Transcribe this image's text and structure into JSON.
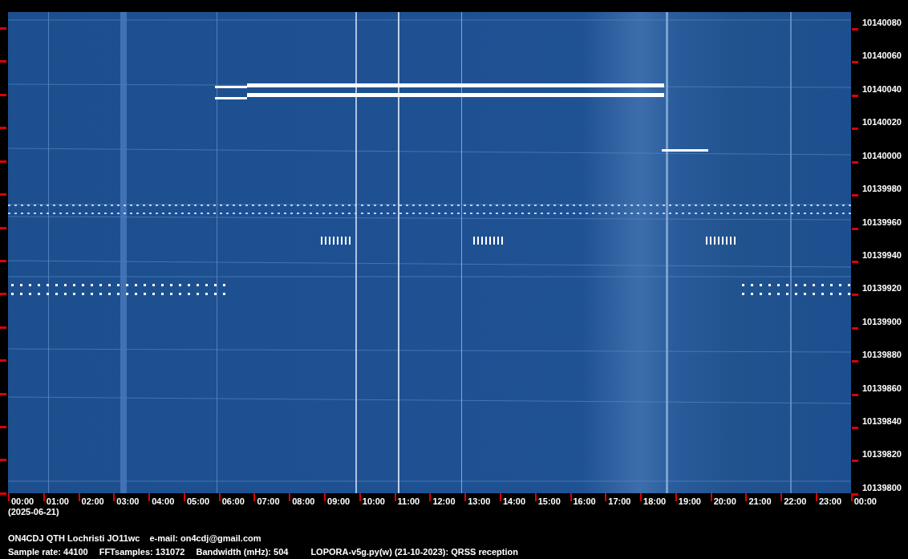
{
  "spectrogram": {
    "y_axis_labels": [
      "10140080",
      "10140060",
      "10140040",
      "10140020",
      "10140000",
      "10139980",
      "10139960",
      "10139940",
      "10139920",
      "10139900",
      "10139880",
      "10139860",
      "10139840",
      "10139820",
      "10139800"
    ],
    "x_axis_labels": [
      "00:00",
      "01:00",
      "02:00",
      "03:00",
      "04:00",
      "05:00",
      "06:00",
      "07:00",
      "08:00",
      "09:00",
      "10:00",
      "11:00",
      "12:00",
      "13:00",
      "14:00",
      "15:00",
      "16:00",
      "17:00",
      "18:00",
      "19:00",
      "20:00",
      "21:00",
      "22:00",
      "23:00",
      "00:00"
    ]
  },
  "date": "(2025-06-21)",
  "station": "ON4CDJ QTH Lochristi JO11wc",
  "email": "e-mail: on4cdj@gmail.com",
  "parameters": [
    "Sample rate: 44100",
    "FFTsamples: 131072",
    "Bandwidth (mHz): 504"
  ],
  "program": "LOPORA-v5g.py(w) (21-10-2023): QRSS reception"
}
